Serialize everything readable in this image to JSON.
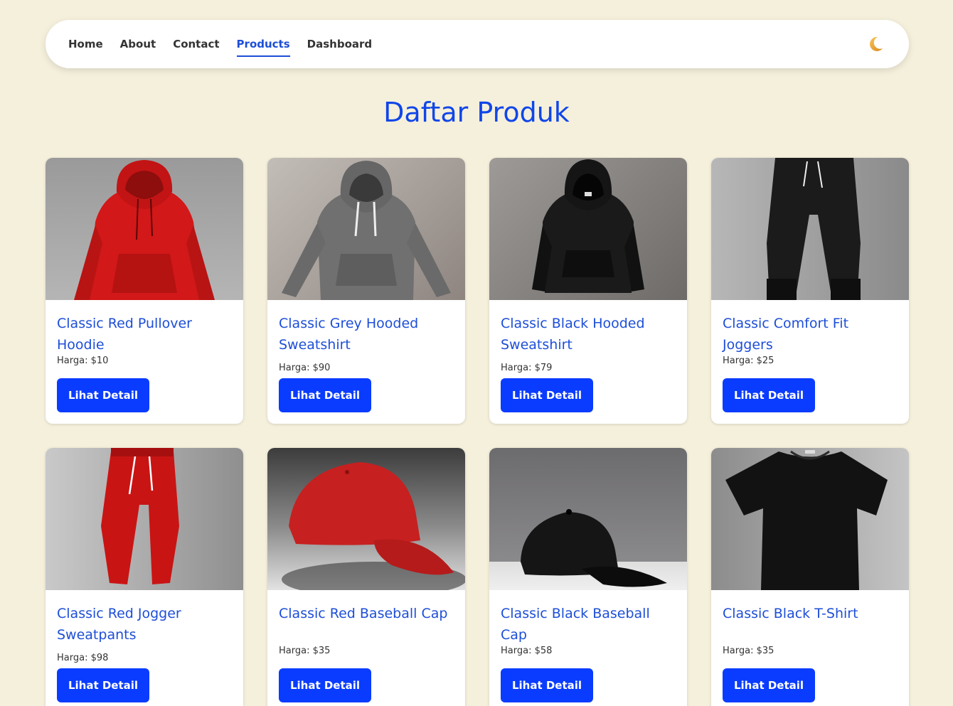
{
  "nav": {
    "items": [
      {
        "label": "Home",
        "active": false
      },
      {
        "label": "About",
        "active": false
      },
      {
        "label": "Contact",
        "active": false
      },
      {
        "label": "Products",
        "active": true
      },
      {
        "label": "Dashboard",
        "active": false
      }
    ],
    "theme_icon": "moon-icon"
  },
  "page": {
    "title": "Daftar Produk"
  },
  "colors": {
    "background": "#f5f0dc",
    "accent": "#1d4ed8",
    "button": "#0a3cff"
  },
  "products": [
    {
      "name": "Classic Red Pullover Hoodie",
      "price": "Harga: $10",
      "button": "Lihat Detail",
      "image": "red-hoodie-image"
    },
    {
      "name": "Classic Grey Hooded Sweatshirt",
      "price": "Harga: $90",
      "button": "Lihat Detail",
      "image": "grey-hoodie-image"
    },
    {
      "name": "Classic Black Hooded Sweatshirt",
      "price": "Harga: $79",
      "button": "Lihat Detail",
      "image": "black-hoodie-image"
    },
    {
      "name": "Classic Comfort Fit Joggers",
      "price": "Harga: $25",
      "button": "Lihat Detail",
      "image": "black-joggers-image"
    },
    {
      "name": "Classic Red Jogger Sweatpants",
      "price": "Harga: $98",
      "button": "Lihat Detail",
      "image": "red-joggers-image"
    },
    {
      "name": "Classic Red Baseball Cap",
      "price": "Harga: $35",
      "button": "Lihat Detail",
      "image": "red-cap-image"
    },
    {
      "name": "Classic Black Baseball Cap",
      "price": "Harga: $58",
      "button": "Lihat Detail",
      "image": "black-cap-image"
    },
    {
      "name": "Classic Black T-Shirt",
      "price": "Harga: $35",
      "button": "Lihat Detail",
      "image": "black-tshirt-image"
    }
  ]
}
